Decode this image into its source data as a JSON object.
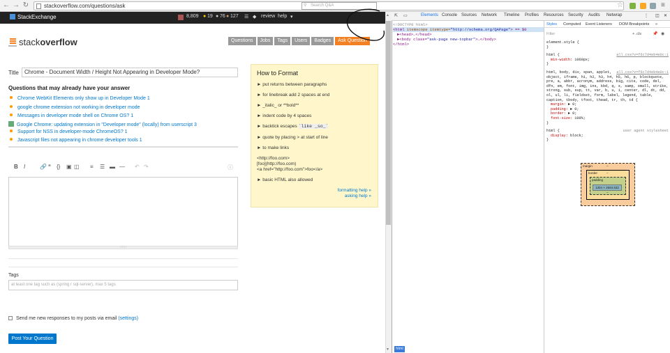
{
  "browser": {
    "url": "stackoverflow.com/questions/ask"
  },
  "se_topbar": {
    "brand": "StackExchange",
    "reputation": "8,809",
    "badges_gold": "19",
    "badges_silver": "76",
    "badges_bronze": "127",
    "review": "review",
    "help": "help",
    "search_placeholder": "Search Q&A"
  },
  "header": {
    "logo_text_plain": "stack",
    "logo_text_bold": "overflow",
    "nav": [
      "Questions",
      "Jobs",
      "Tags",
      "Users",
      "Badges",
      "Ask Question"
    ]
  },
  "form": {
    "title_label": "Title",
    "title_value": "Chrome - Document Width / Height Not Appearing in Developer Mode?",
    "suggest_heading": "Questions that may already have your answer",
    "suggestions": [
      "Chrome WebKit Elements only show up in Developer Mode 1",
      "google chrome extension not working in developer mode",
      "Messages in developer mode shell on Chrome OS? 1",
      "Google Chrome: updating extension in \"Developer mode\" (locally) from userscript 3",
      "Support for NSS in developer-mode ChromeOS? 1",
      "Javascript files not appearing in chrome developer tools 1"
    ],
    "resize_grip": "∷∷∷",
    "tags_label": "Tags",
    "tags_placeholder": "at least one tag such as (spring r sql-server), max 5 tags",
    "notify_text": "Send me new responses to my posts via email",
    "notify_link": "(settings)",
    "post_button": "Post Your Question"
  },
  "how_to_format": {
    "heading": "How to Format",
    "items": [
      "► put returns between paragraphs",
      "► for linebreak add 2 spaces at end",
      "► _italic_ or **bold**",
      "► indent code by 4 spaces",
      "► backtick escapes",
      "► quote by placing > at start of line",
      "► to make links"
    ],
    "backtick_code": "`like _so_`",
    "link_examples": [
      "<http://foo.com>",
      "[foo](http://foo.com)",
      "<a href=\"http://foo.com\">foo</a>"
    ],
    "html_allowed": "► basic HTML also allowed",
    "formatting_help": "formatting help »",
    "asking_help": "asking help »"
  },
  "devtools": {
    "tabs": [
      "Elements",
      "Console",
      "Sources",
      "Network",
      "Timeline",
      "Profiles",
      "Resources",
      "Security",
      "Audits",
      "Netwrap"
    ],
    "elements": {
      "line1": "<!DOCTYPE html>",
      "line2_tag": "<html",
      "line2_attr": " itemscope itemtype=",
      "line2_val": "\"http://schema.org/QAPage\"",
      "line2_end": "> == $0",
      "line3": "►<head>…</head>",
      "line4_tag": "►<body class=",
      "line4_val": "\"ask-page new-topbar\"",
      "line4_end": ">…</body>",
      "line5": "</html>",
      "crumb": "html"
    },
    "styles_tabs": [
      "Styles",
      "Computed",
      "Event Listeners",
      "DOM Breakpoints",
      "»"
    ],
    "filter": "Filter",
    "filter_tools": "+ .cls",
    "css": {
      "el_style": "element.style {",
      "close": "}",
      "html_sel": "html {",
      "html_src": "all.css?v=f6c7d4eb4e0c:1",
      "html_minwidth": "min-width:",
      "html_minwidth_val": " 1060px;",
      "reset_sel": "html, body, div, span, applet, object, iframe, h1, h2, h3, h4, h5, h6, p, blockquote, pre, a, abbr, acronym, address, big, cite, code, del, dfn, em, font, img, ins, kbd, q, s, samp, small, strike, strong, sub, sup, tt, var, b, u, i, center, dl, dt, dd, ol, ul, li, fieldset, form, label, legend, table, caption, tbody, tfoot, thead, tr, th, td {",
      "reset_src": "all.css?v=f6c7d4eb4e0c:1",
      "margin": "margin:",
      "padding": "padding:",
      "border": "border:",
      "fontsize": "font-size:",
      "margin_val": " ► 0;",
      "padding_val": " ► 0;",
      "border_val": " ► 0;",
      "fontsize_val": " 100%;",
      "ua_sel": "html {",
      "ua_src": "user agent stylesheet",
      "display": "display:",
      "display_val": " block;"
    },
    "boxmodel": {
      "margin": "margin",
      "border": "border",
      "padding": "padding",
      "dash": "–",
      "content": "1304 × 2594.532"
    }
  },
  "colors": {
    "accent": "#f48024",
    "link": "#0077cc",
    "format_bg": "#fff7cb"
  }
}
